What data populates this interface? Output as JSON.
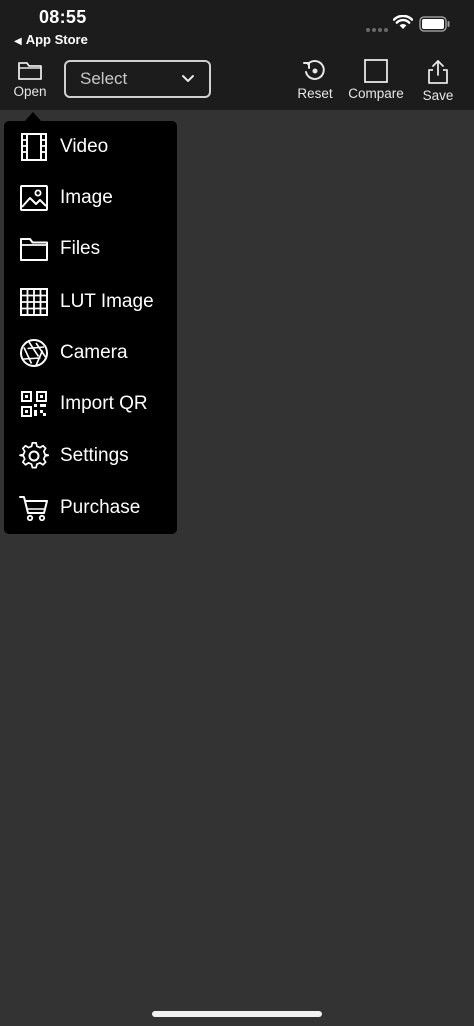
{
  "status": {
    "time": "08:55",
    "back_label": "App Store"
  },
  "toolbar": {
    "open_label": "Open",
    "select_value": "Select",
    "reset_label": "Reset",
    "compare_label": "Compare",
    "save_label": "Save"
  },
  "menu": {
    "items": [
      {
        "label": "Video",
        "icon": "film-icon"
      },
      {
        "label": "Image",
        "icon": "image-icon"
      },
      {
        "label": "Files",
        "icon": "folder-icon"
      },
      {
        "label": "LUT Image",
        "icon": "grid-icon"
      },
      {
        "label": "Camera",
        "icon": "aperture-icon"
      },
      {
        "label": "Import QR",
        "icon": "qr-code-icon"
      },
      {
        "label": "Settings",
        "icon": "gear-icon"
      },
      {
        "label": "Purchase",
        "icon": "cart-icon"
      }
    ]
  }
}
